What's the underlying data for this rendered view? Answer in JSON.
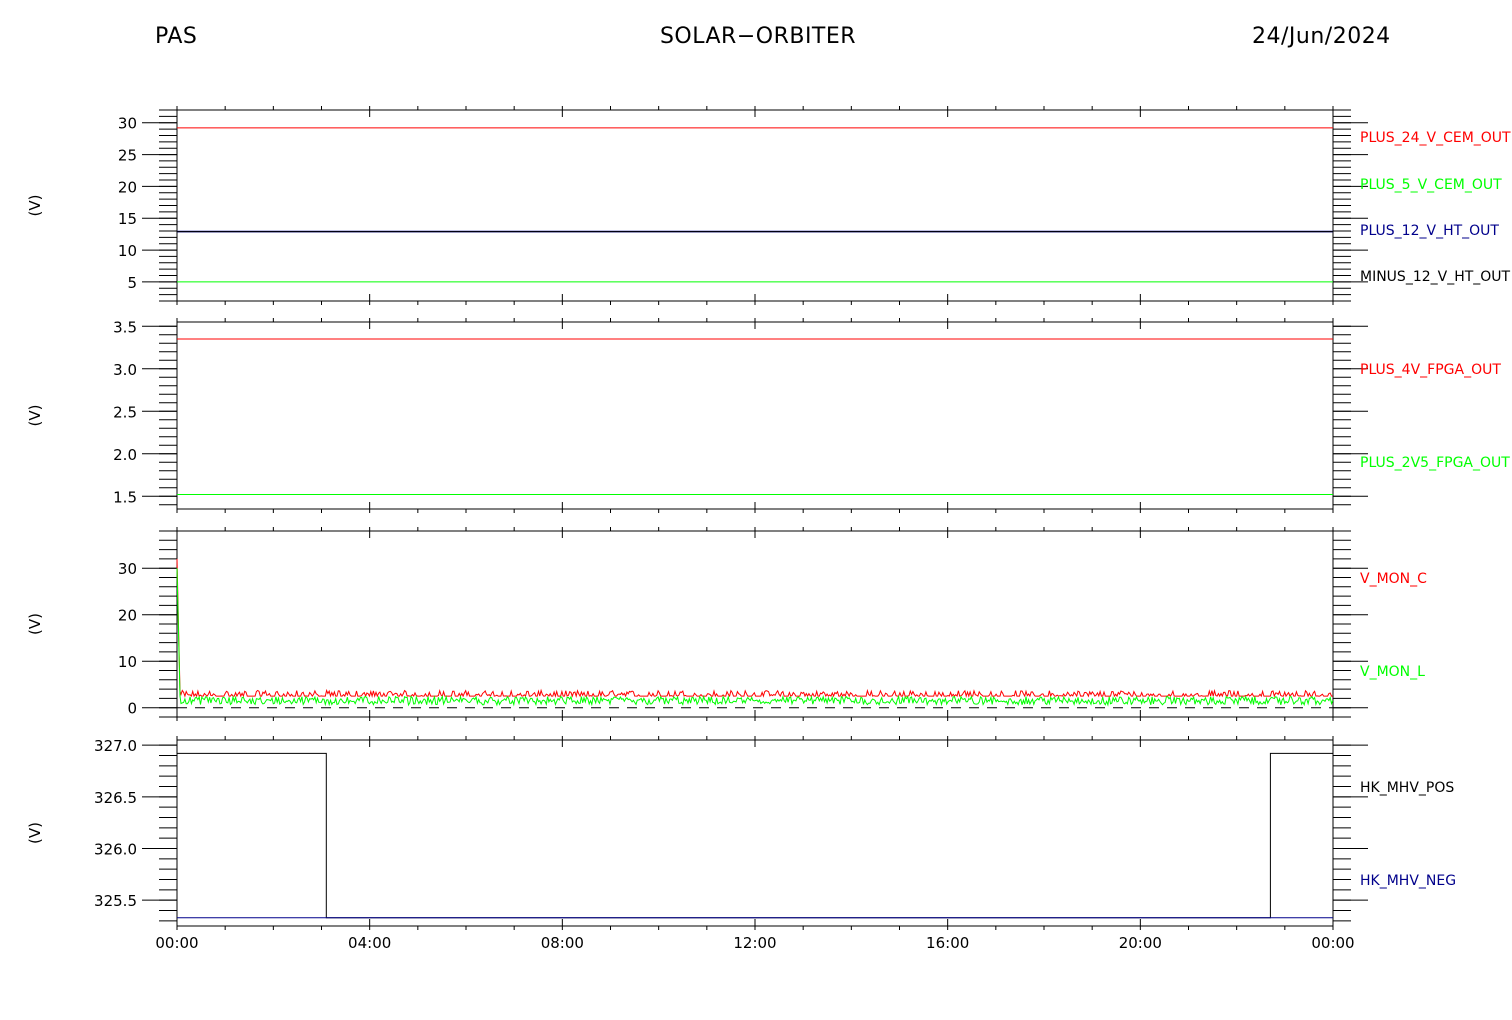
{
  "header": {
    "left": "PAS",
    "center": "SOLAR−ORBITER",
    "right": "24/Jun/2024"
  },
  "colors": {
    "red": "#ff0000",
    "green": "#00ff00",
    "blue": "#00008b",
    "black": "#000000"
  },
  "chart_data": [
    {
      "type": "line",
      "ylabel": "(V)",
      "ylim": [
        2,
        32
      ],
      "yticks": [
        5,
        10,
        15,
        20,
        25,
        30
      ],
      "ytick_labels": [
        "5",
        "10",
        "15",
        "20",
        "25",
        "30"
      ],
      "yminor": 1,
      "series": [
        {
          "name": "PLUS_24_V_CEM_OUT",
          "color": "#ff0000",
          "constant": 29.2
        },
        {
          "name": "PLUS_5_V_CEM_OUT",
          "color": "#00ff00",
          "constant": 5.0
        },
        {
          "name": "PLUS_12_V_HT_OUT",
          "color": "#00008b",
          "constant": 12.9
        },
        {
          "name": "MINUS_12_V_HT_OUT",
          "color": "#000000",
          "constant": 12.9
        }
      ]
    },
    {
      "type": "line",
      "ylabel": "(V)",
      "ylim": [
        1.35,
        3.55
      ],
      "yticks": [
        1.5,
        2.0,
        2.5,
        3.0,
        3.5
      ],
      "ytick_labels": [
        "1.5",
        "2.0",
        "2.5",
        "3.0",
        "3.5"
      ],
      "yminor": 0.1,
      "series": [
        {
          "name": "PLUS_4V_FPGA_OUT",
          "color": "#ff0000",
          "constant": 3.35
        },
        {
          "name": "PLUS_2V5_FPGA_OUT",
          "color": "#00ff00",
          "constant": 1.52
        }
      ]
    },
    {
      "type": "line",
      "ylabel": "(V)",
      "ylim": [
        -2,
        38
      ],
      "yticks": [
        0,
        10,
        20,
        30
      ],
      "ytick_labels": [
        "0",
        "10",
        "20",
        "30"
      ],
      "yminor": 2,
      "reference_line": 0,
      "series": [
        {
          "name": "V_MON_C",
          "color": "#ff0000",
          "start_value": 32,
          "baseline": 2.5,
          "noise_high": 3.7
        },
        {
          "name": "V_MON_L",
          "color": "#00ff00",
          "start_value": 30,
          "baseline": 1.5,
          "noise_low": 0.6,
          "noise_high": 2.4
        }
      ]
    },
    {
      "type": "line",
      "ylabel": "(V)",
      "ylim": [
        325.25,
        327.05
      ],
      "yticks": [
        325.5,
        326.0,
        326.5,
        327.0
      ],
      "ytick_labels": [
        "325.5",
        "326.0",
        "326.5",
        "327.0"
      ],
      "yminor": 0.1,
      "series": [
        {
          "name": "HK_MHV_POS",
          "color": "#000000",
          "x_hours": [
            0,
            3.1,
            3.1,
            22.7,
            22.7,
            24
          ],
          "values": [
            326.92,
            326.92,
            325.33,
            325.33,
            326.92,
            326.92
          ]
        },
        {
          "name": "HK_MHV_NEG",
          "color": "#00008b",
          "x_hours": [
            0,
            24
          ],
          "values": [
            325.33,
            325.33
          ]
        }
      ]
    }
  ],
  "xaxis": {
    "ticks_hours": [
      0,
      4,
      8,
      12,
      16,
      20,
      24
    ],
    "tick_labels": [
      "00:00",
      "04:00",
      "08:00",
      "12:00",
      "16:00",
      "20:00",
      "00:00"
    ],
    "minor_hours": 1,
    "range_hours": [
      0,
      24
    ]
  }
}
